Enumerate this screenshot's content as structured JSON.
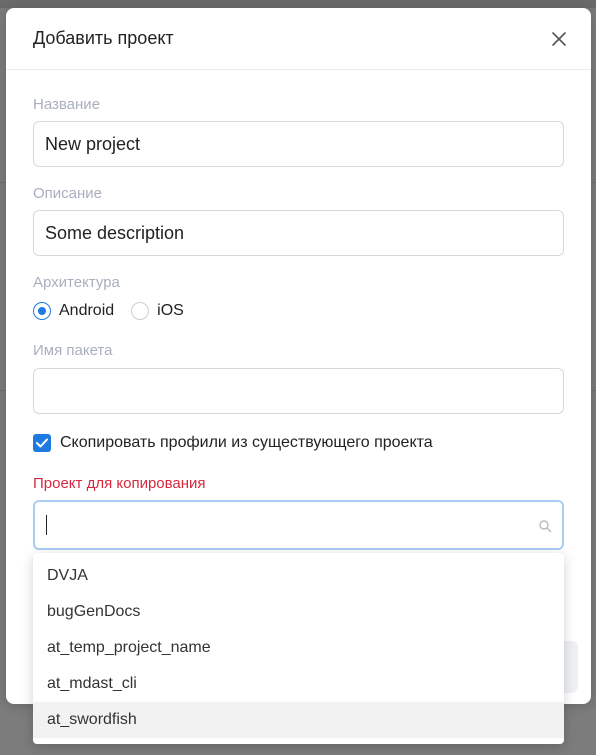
{
  "modal": {
    "title": "Добавить проект",
    "close_icon": "close-icon"
  },
  "form": {
    "name_label": "Название",
    "name_value": "New project",
    "description_label": "Описание",
    "description_value": "Some description",
    "arch_label": "Архитектура",
    "arch_options": [
      {
        "label": "Android",
        "selected": true
      },
      {
        "label": "iOS",
        "selected": false
      }
    ],
    "package_label": "Имя пакета",
    "package_value": "",
    "copy_profiles_label": "Скопировать профили из существующего проекта",
    "copy_profiles_checked": true,
    "copy_from_label": "Проект для копирования",
    "copy_from_search": ""
  },
  "dropdown": {
    "items": [
      "DVJA",
      "bugGenDocs",
      "at_temp_project_name",
      "at_mdast_cli",
      "at_swordfish"
    ],
    "hover_index": 4
  },
  "colors": {
    "accent": "#1f7ae0",
    "label": "#a9afbf",
    "error": "#d6283e"
  }
}
